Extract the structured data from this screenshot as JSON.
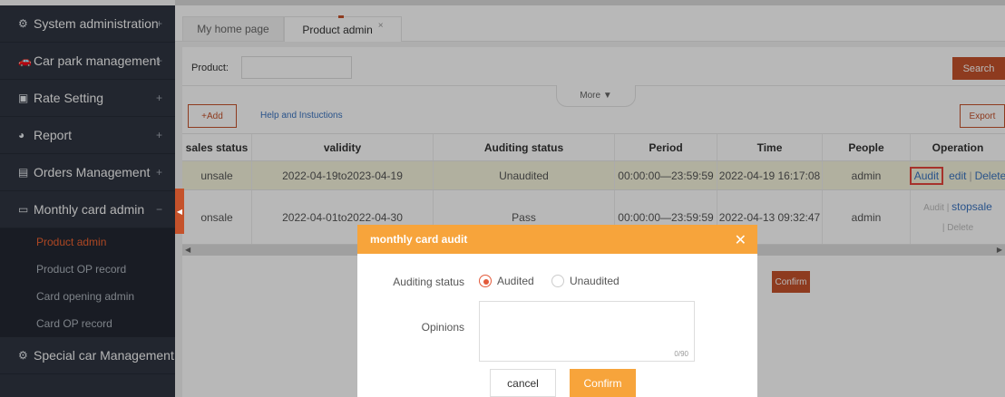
{
  "sidebar": {
    "groups": [
      {
        "icon": "⚙",
        "label": "System administration",
        "toggle": "+"
      },
      {
        "icon": "🚗",
        "label": "Car park management",
        "toggle": "+"
      },
      {
        "icon": "▣",
        "label": "Rate Setting",
        "toggle": "+"
      },
      {
        "icon": "◕",
        "label": "Report",
        "toggle": "+"
      },
      {
        "icon": "▤",
        "label": "Orders Management",
        "toggle": "+"
      },
      {
        "icon": "▭",
        "label": "Monthly card admin",
        "toggle": "−"
      },
      {
        "icon": "⚙",
        "label": "Special car Management",
        "toggle": ""
      }
    ],
    "subitems": [
      "Product admin",
      "Product OP record",
      "Card opening admin",
      "Card OP record"
    ]
  },
  "tabs": {
    "home": "My home page",
    "active": "Product admin",
    "close": "×"
  },
  "filter": {
    "product_label": "Product:",
    "product_value": "",
    "search_label": "Search",
    "more_label": "More ▼"
  },
  "toolbar": {
    "add_label": "+Add",
    "help_label": "Help and Instuctions",
    "export_label": "Export"
  },
  "table": {
    "headers": [
      "sales status",
      "validity",
      "Auditing status",
      "Period",
      "Time",
      "People",
      "Operation"
    ],
    "rows": [
      {
        "sales_status": "unsale",
        "validity": "2022-04-19to2023-04-19",
        "auditing": "Unaudited",
        "period": "00:00:00—23:59:59",
        "time": "2022-04-19 16:17:08",
        "people": "admin",
        "op_audit": "Audit",
        "op_edit": "edit",
        "op_sep": "|",
        "op_delete": "Delete"
      },
      {
        "sales_status": "onsale",
        "validity": "2022-04-01to2022-04-30",
        "auditing": "Pass",
        "period": "00:00:00—23:59:59",
        "time": "2022-04-13 09:32:47",
        "people": "admin",
        "op_audit": "Audit",
        "op_sep": "|",
        "op_stopsale": "stopsale",
        "op_delete": "| Delete"
      }
    ]
  },
  "background_confirm": "Confirm",
  "modal": {
    "title": "monthly card audit",
    "close": "✕",
    "auditing_label": "Auditing status",
    "option_audited": "Audited",
    "option_unaudited": "Unaudited",
    "selected": "Audited",
    "opinions_label": "Opinions",
    "opinions_value": "",
    "counter": "0/90",
    "cancel_label": "cancel",
    "confirm_label": "Confirm"
  },
  "colors": {
    "sidebar_bg": "#2a2f3a",
    "accent": "#c5522b",
    "modal_header": "#f7a43b",
    "link": "#3a73c0",
    "row_highlight": "#f5f4dd",
    "audit_highlight": "#e6463c"
  }
}
